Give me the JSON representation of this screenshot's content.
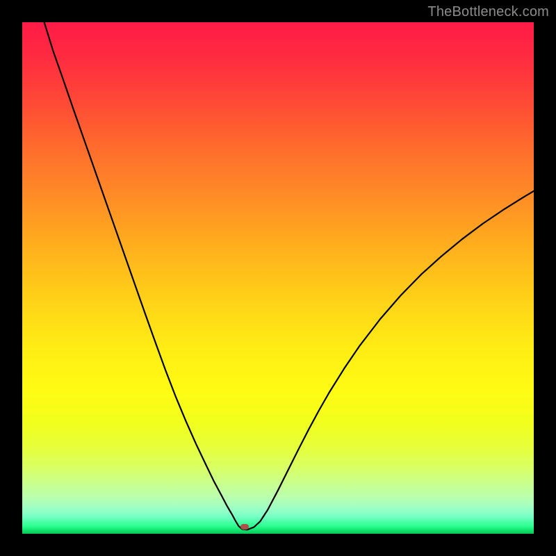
{
  "watermark": "TheBottleneck.com",
  "chart_data": {
    "type": "line",
    "title": "",
    "xlabel": "",
    "ylabel": "",
    "xlim": [
      0,
      100
    ],
    "ylim": [
      0,
      100
    ],
    "minimum_x": 43,
    "curve": [
      {
        "x": 4.3,
        "y": 100.0
      },
      {
        "x": 6.0,
        "y": 94.5
      },
      {
        "x": 8.0,
        "y": 88.8
      },
      {
        "x": 10.0,
        "y": 83.0
      },
      {
        "x": 12.0,
        "y": 77.3
      },
      {
        "x": 14.0,
        "y": 71.6
      },
      {
        "x": 16.0,
        "y": 65.9
      },
      {
        "x": 18.0,
        "y": 60.2
      },
      {
        "x": 20.0,
        "y": 54.5
      },
      {
        "x": 22.0,
        "y": 48.8
      },
      {
        "x": 24.0,
        "y": 43.1
      },
      {
        "x": 26.0,
        "y": 37.5
      },
      {
        "x": 28.0,
        "y": 32.0
      },
      {
        "x": 30.0,
        "y": 26.8
      },
      {
        "x": 32.0,
        "y": 22.0
      },
      {
        "x": 34.0,
        "y": 17.5
      },
      {
        "x": 36.0,
        "y": 13.3
      },
      {
        "x": 37.5,
        "y": 10.2
      },
      {
        "x": 39.0,
        "y": 7.4
      },
      {
        "x": 40.0,
        "y": 5.5
      },
      {
        "x": 41.0,
        "y": 3.8
      },
      {
        "x": 41.7,
        "y": 2.5
      },
      {
        "x": 42.3,
        "y": 1.5
      },
      {
        "x": 43.0,
        "y": 0.9
      },
      {
        "x": 44.0,
        "y": 0.8
      },
      {
        "x": 45.3,
        "y": 1.3
      },
      {
        "x": 46.5,
        "y": 2.4
      },
      {
        "x": 48.0,
        "y": 4.7
      },
      {
        "x": 50.0,
        "y": 8.5
      },
      {
        "x": 52.0,
        "y": 12.5
      },
      {
        "x": 54.0,
        "y": 16.5
      },
      {
        "x": 56.0,
        "y": 20.4
      },
      {
        "x": 58.0,
        "y": 24.1
      },
      {
        "x": 60.0,
        "y": 27.6
      },
      {
        "x": 63.0,
        "y": 32.4
      },
      {
        "x": 66.0,
        "y": 36.8
      },
      {
        "x": 70.0,
        "y": 42.0
      },
      {
        "x": 74.0,
        "y": 46.6
      },
      {
        "x": 78.0,
        "y": 50.7
      },
      {
        "x": 82.0,
        "y": 54.3
      },
      {
        "x": 86.0,
        "y": 57.6
      },
      {
        "x": 90.0,
        "y": 60.6
      },
      {
        "x": 94.0,
        "y": 63.3
      },
      {
        "x": 98.0,
        "y": 65.8
      },
      {
        "x": 100.0,
        "y": 67.0
      }
    ],
    "marker": {
      "x": 43.5,
      "y": 1.3,
      "color": "#a95348"
    },
    "background_gradient": {
      "top": "#ff1a47",
      "middle": "#ffd717",
      "bottom": "#08c45a"
    }
  }
}
